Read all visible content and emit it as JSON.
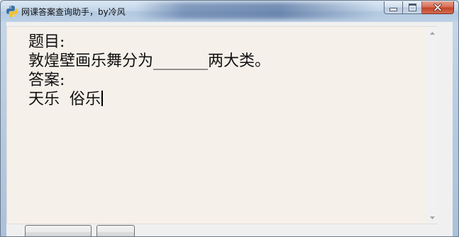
{
  "window": {
    "title": "网课答案查询助手，by冷风"
  },
  "icons": {
    "app": "python-icon",
    "minimize": "minimize-icon",
    "maximize": "maximize-icon",
    "close": "close-icon",
    "scroll_up": "arrow-up-icon",
    "scroll_down": "arrow-down-icon"
  },
  "content": {
    "question_label": "题目:",
    "question_text": "敦煌壁画乐舞分为_______两大类。",
    "answer_label": "答案:",
    "answer_text": "天乐  俗乐"
  },
  "colors": {
    "text_area_bg": "#f5f0ea",
    "close_button": "#c2432a"
  }
}
